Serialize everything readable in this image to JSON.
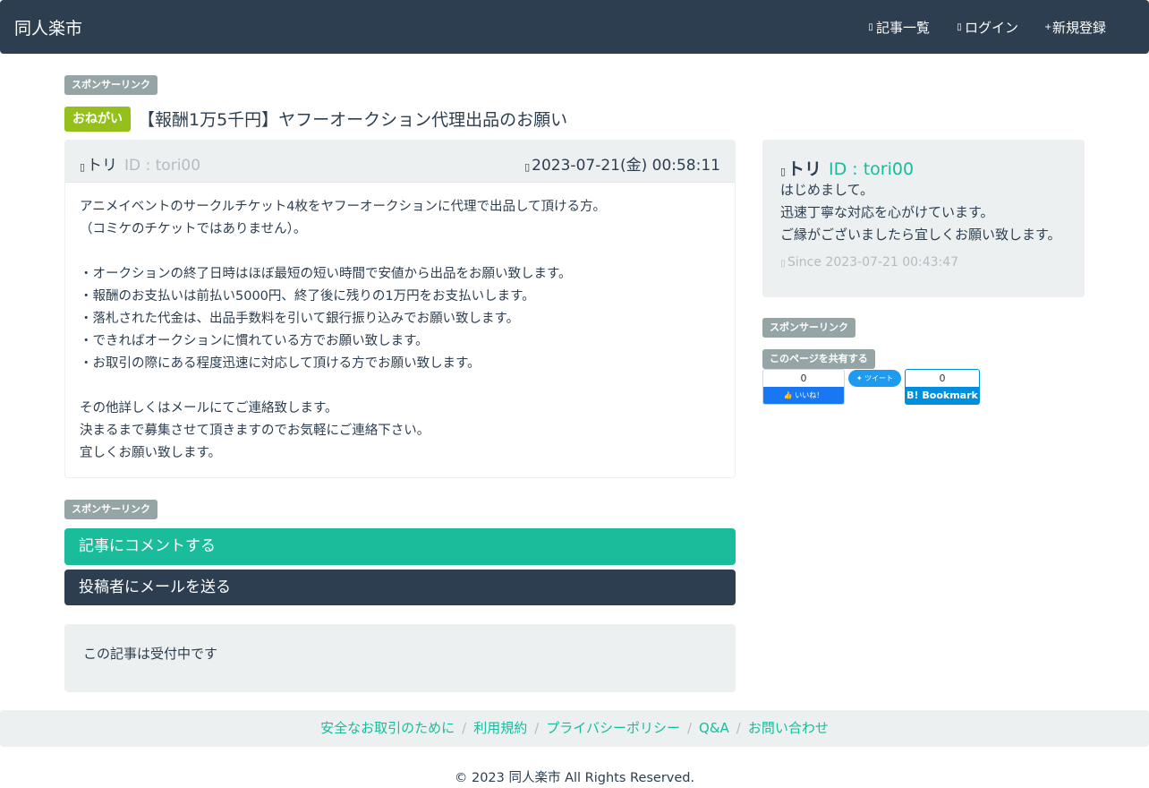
{
  "navbar": {
    "brand": "同人楽市",
    "items": [
      {
        "icon": "list-icon",
        "glyph": "▯",
        "label": "記事一覧"
      },
      {
        "icon": "login-icon",
        "glyph": "▯",
        "label": "ログイン"
      },
      {
        "icon": "plus-icon",
        "glyph": "+",
        "label": "新規登録"
      }
    ]
  },
  "sponsor_label": "スポンサーリンク",
  "post": {
    "tag": "おねがい",
    "title": "【報酬1万5千円】ヤフーオークション代理出品のお願い",
    "author_name": "トリ",
    "author_id": "ID : tori00",
    "date": "2023-07-21(金) 00:58:11",
    "body_lines": [
      "アニメイベントのサークルチケット4枚をヤフーオークションに代理で出品して頂ける方。",
      "（コミケのチケットではありません）。",
      "",
      "・オークションの終了日時はほぼ最短の短い時間で安値から出品をお願い致します。",
      "・報酬のお支払いは前払い5000円、終了後に残りの1万円をお支払いします。",
      "・落札された代金は、出品手数料を引いて銀行振り込みでお願い致します。",
      "・できればオークションに慣れている方でお願い致します。",
      "・お取引の際にある程度迅速に対応して頂ける方でお願い致します。",
      "",
      "その他詳しくはメールにてご連絡致します。",
      "決まるまで募集させて頂きますのでお気軽にご連絡下さい。",
      "宜しくお願い致します。"
    ]
  },
  "actions": {
    "comment": "記事にコメントする",
    "mail": "投稿者にメールを送る"
  },
  "status": "この記事は受付中です",
  "profile": {
    "name": "トリ",
    "id": "ID : tori00",
    "lines": [
      "はじめまして。",
      "迅速丁寧な対応を心がけています。",
      "ご縁がございましたら宜しくお願い致します。"
    ],
    "since": "Since 2023-07-21 00:43:47"
  },
  "share": {
    "label": "このページを共有する",
    "fb_count": "0",
    "fb_button": "いいね！",
    "tw_button": "ツイート",
    "hb_count": "0",
    "hb_button": "B! Bookmark"
  },
  "footer": {
    "links": [
      "安全なお取引のために",
      "利用規約",
      "プライバシーポリシー",
      "Q&A",
      "お問い合わせ"
    ],
    "copyright": "© 2023 同人楽市 All Rights Reserved."
  },
  "colors": {
    "navbar": "#2c3e50",
    "accent": "#18bc9c",
    "tag": "#95c01c",
    "label": "#95a5a6",
    "panel": "#ecf0f1"
  }
}
